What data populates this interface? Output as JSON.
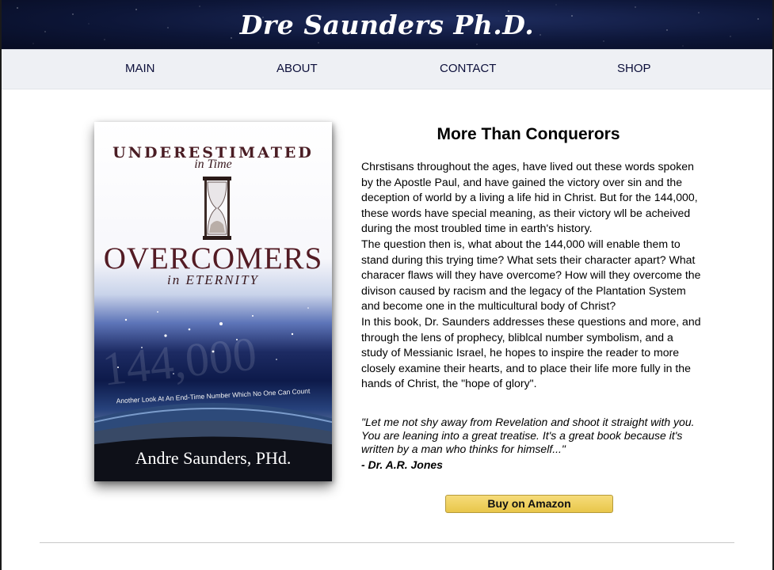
{
  "header": {
    "site_title": "Dre Saunders Ph.D."
  },
  "nav": {
    "items": [
      {
        "label": "MAIN"
      },
      {
        "label": "ABOUT"
      },
      {
        "label": "CONTACT"
      },
      {
        "label": "SHOP"
      }
    ]
  },
  "book": {
    "cover": {
      "title_line1": "UNDERESTIMATED",
      "title_line2": "in Time",
      "title_line3": "OVERCOMERS",
      "title_line4": "in ETERNITY",
      "tagline": "Another Look At An End-Time Number Which No One Can Count",
      "author": "Andre Saunders, PHd.",
      "watermark": "144,000"
    },
    "title": "More Than Conquerors",
    "description": [
      "Chrstisans throughout the ages, have lived out these words spoken by the Apostle Paul, and have gained the victory over sin and the deception of world by a living a life hid in Christ. But for the 144,000, these words have special meaning, as their victory wll be acheived during the most troubled time in earth's history.",
      "The question then is, what about the 144,000 will enable them to stand during this trying time? What sets their character apart? What characer flaws will they have overcome? How will they overcome the divison caused by racism and the legacy of the Plantation System and become one in the multicultural body of Christ?",
      "In this book, Dr. Saunders addresses these questions and more, and through the lens of prophecy, bliblcal number symbolism, and a study of Messianic Israel, he hopes to inspire the reader to more closely examine their hearts, and to place their life more fully in the hands of Christ, the \"hope of glory\"."
    ],
    "quote": "\"Let me not shy away from Revelation and shoot it straight with you. You are leaning into a great treatise. It's a great book because it's written by a man who thinks for himself...\"",
    "quote_author": "- Dr. A.R. Jones",
    "buy_button": "Buy on Amazon"
  },
  "colors": {
    "header_bg": "#0d1638",
    "nav_bg": "#eef0f4",
    "nav_text": "#0c0f3a",
    "button": "#f0d060"
  }
}
